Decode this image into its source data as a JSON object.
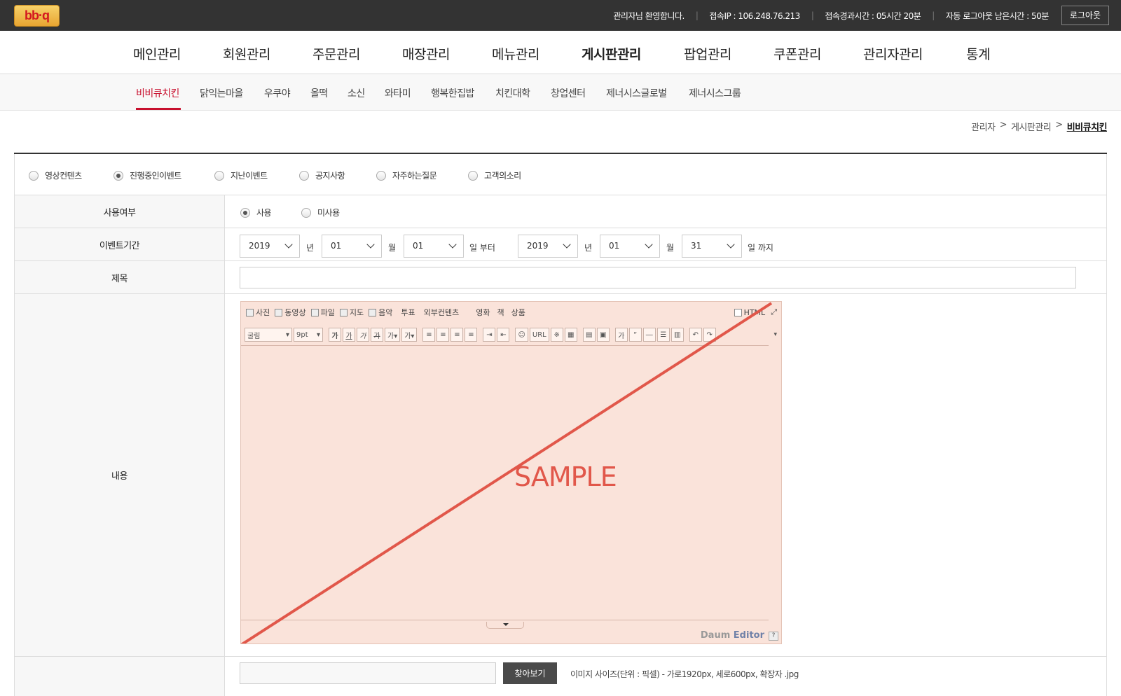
{
  "header": {
    "logo_text": "bb·q",
    "welcome": "관리자님 환영합니다.",
    "ip": "접속IP : 106.248.76.213",
    "elapsed": "접속경과시간 : 05시간 20분",
    "remaining": "자동 로그아웃 남은시간 : 50분",
    "logout_label": "로그아웃"
  },
  "main_nav": {
    "items": [
      "메인관리",
      "회원관리",
      "주문관리",
      "매장관리",
      "메뉴관리",
      "게시판관리",
      "팝업관리",
      "쿠폰관리",
      "관리자관리",
      "통계"
    ],
    "active": "게시판관리"
  },
  "sub_nav": {
    "items": [
      "비비큐치킨",
      "닭익는마을",
      "우쿠야",
      "올떡",
      "소신",
      "와타미",
      "행복한집밥",
      "치킨대학",
      "창업센터",
      "제너시스글로벌",
      "제너시스그룹"
    ],
    "active": "비비큐치킨"
  },
  "breadcrumb": {
    "items": [
      "관리자",
      "게시판관리",
      "비비큐치킨"
    ],
    "separator": ">"
  },
  "board_types": {
    "options": [
      "영상컨텐츠",
      "진행중인이벤트",
      "지난이벤트",
      "공지사항",
      "자주하는질문",
      "고객의소리"
    ],
    "selected": "진행중인이벤트"
  },
  "form": {
    "use_label": "사용여부",
    "use_options": [
      "사용",
      "미사용"
    ],
    "use_selected": "사용",
    "period_label": "이벤트기간",
    "start": {
      "year": "2019",
      "month": "01",
      "day": "01"
    },
    "end": {
      "year": "2019",
      "month": "01",
      "day": "31"
    },
    "unit_year": "년",
    "unit_month": "월",
    "from_suffix": "일 부터",
    "to_suffix": "일 까지",
    "title_label": "제목",
    "title_value": "",
    "content_label": "내용",
    "file_value": "",
    "find_label": "찾아보기",
    "image_note": "이미지 사이즈(단위 : 픽셀) - 가로1920px, 세로600px, 확장자 .jpg"
  },
  "editor": {
    "toolbar1": [
      "사진",
      "동영상",
      "파일",
      "지도",
      "음악",
      "투표",
      "외부컨텐츠",
      "영화",
      "책",
      "상품"
    ],
    "html_toggle": "HTML",
    "font_name": "굴림",
    "font_size": "9pt",
    "url_label": "URL",
    "brand_a": "Daum",
    "brand_b": "Editor",
    "help": "?",
    "sample_text": "SAMPLE"
  },
  "colors": {
    "topbar": "#333333",
    "accent": "#c8102e",
    "editor_bg": "#fae3da",
    "sample_red": "#e1574a"
  }
}
